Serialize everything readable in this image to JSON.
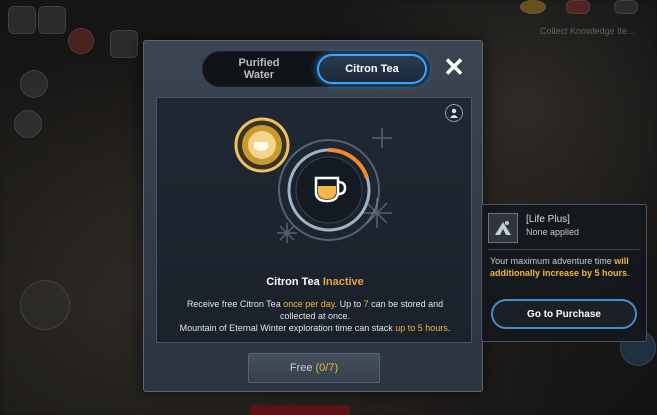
{
  "tabs": [
    {
      "label_line1": "Purified",
      "label_line2": "Water",
      "active": false
    },
    {
      "label": "Citron Tea",
      "active": true
    }
  ],
  "close_glyph": "✕",
  "info_icon": "guide-icon",
  "status": {
    "prefix": "Citron Tea",
    "state": "Inactive"
  },
  "description": {
    "part1": "Receive free Citron Tea ",
    "part2": "once per day",
    "part3": ". Up to ",
    "part4": "7",
    "part5": " can be stored and collected at once.",
    "part6": "Mountain of Eternal Winter exploration time can stack ",
    "part7": "up to 5 hours",
    "part8": "."
  },
  "free_button": {
    "label": "Free",
    "count": "(0/7)"
  },
  "life_plus": {
    "title": "[Life Plus]",
    "subtitle": "None applied",
    "desc_part1": "Your maximum adventure time ",
    "desc_part2": "will additionally increase by 5 hours",
    "desc_part3": ".",
    "button_label": "Go to Purchase"
  },
  "background": {
    "top_right_label": "Collect Knowledge Ite..."
  },
  "colors": {
    "accent_blue": "#3aa3ff",
    "highlight_gold": "#f0b43c",
    "inactive_orange": "#e6a43a"
  }
}
